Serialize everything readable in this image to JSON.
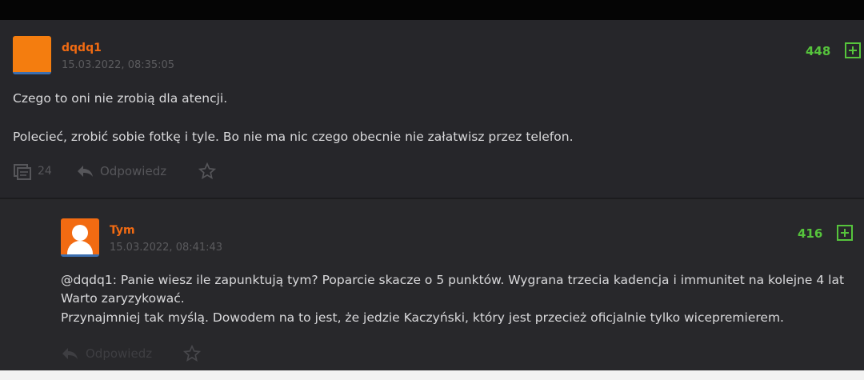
{
  "comments": [
    {
      "username": "dqdq1",
      "date": "15.03.2022, 08:35:05",
      "score": "448",
      "lines": [
        "Czego to oni nie zrobią dla atencji.",
        "Polecieć, zrobić sobie fotkę i tyle. Bo nie ma nic czego obecnie nie załatwisz przez telefon."
      ],
      "replies_count": "24",
      "reply_label": "Odpowiedz"
    },
    {
      "username": "Tym",
      "date": "15.03.2022, 08:41:43",
      "score": "416",
      "mention": "@dqdq1:",
      "lines": [
        " Panie wiesz ile zapunktują tym? Poparcie skacze o 5 punktów. Wygrana trzecia kadencja i immunitet na kolejne 4 lat",
        "Warto zaryzykować.",
        "Przynajmniej tak myślą. Dowodem na to jest, że jedzie Kaczyński, który jest przecież oficjalnie tylko wicepremierem."
      ],
      "reply_label": "Odpowiedz"
    }
  ],
  "icons": {
    "upvote": "plus-square-icon",
    "comments": "comments-icon",
    "reply": "reply-arrow-icon",
    "favorite": "star-icon",
    "avatar": "user-avatar-icon"
  },
  "colors": {
    "username": "#f26b12",
    "score": "#56c43c",
    "background": "#26262a",
    "text": "#d9d9db"
  }
}
